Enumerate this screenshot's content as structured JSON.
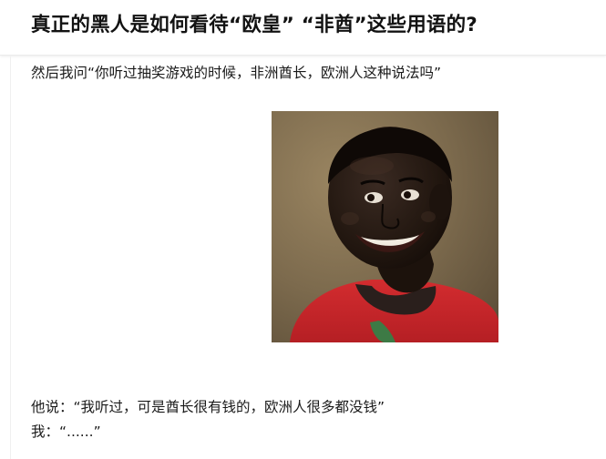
{
  "question": {
    "title": "真正的黑人是如何看待“欧皇” “非酋”这些用语的?"
  },
  "answer": {
    "paragraphs": [
      "然后我问“你听过抽奖游戏的时候，非洲酋长，欧洲人这种说法吗”",
      "他说：“我听过，可是酋长很有钱的，欧洲人很多都没钱”",
      "我：“......”"
    ]
  },
  "colors": {
    "title": "#121212",
    "text": "#1a1a1a",
    "photo_background": "#7a684c",
    "shirt_red": "#c8262a",
    "collar_dark": "#2a1f1c",
    "collar_green": "#3d7a45"
  }
}
